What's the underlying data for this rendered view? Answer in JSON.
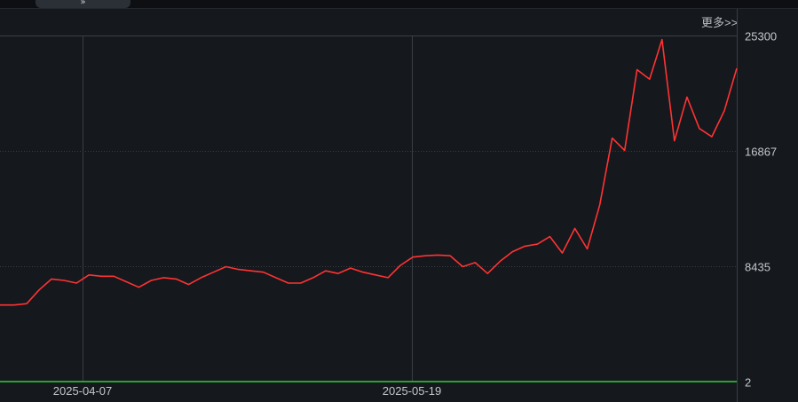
{
  "header": {
    "more_label": "更多>>",
    "collapse_icon": "double-chevron-down-icon"
  },
  "colors": {
    "background": "#15181d",
    "grid": "#3a3e45",
    "axis_text": "#c4c7cc",
    "series_main": "#ff3333",
    "series_baseline": "#2ecc40"
  },
  "chart_data": {
    "type": "line",
    "title": "",
    "xlabel": "",
    "ylabel": "",
    "ylim": [
      2,
      25300
    ],
    "y_ticks": [
      25300,
      16867,
      8435,
      2
    ],
    "x_tick_labels": [
      "2025-04-07",
      "2025-05-19"
    ],
    "y_axis_side": "right",
    "grid": true,
    "series": [
      {
        "values": [
          5600,
          5600,
          5700,
          6700,
          7500,
          7400,
          7200,
          7800,
          7700,
          7700,
          7300,
          6900,
          7400,
          7600,
          7500,
          7100,
          7600,
          8000,
          8400,
          8200,
          8100,
          8000,
          7600,
          7200,
          7200,
          7600,
          8100,
          7900,
          8300,
          8000,
          7800,
          7600,
          8500,
          9100,
          9200,
          9250,
          9200,
          8400,
          8700,
          7900,
          8800,
          9500,
          9900,
          10050,
          10600,
          9400,
          11200,
          9700,
          12900,
          17800,
          16900,
          22800,
          22100,
          25000,
          17600,
          20800,
          18500,
          17900,
          19800,
          22900
        ]
      },
      {
        "values": [
          2,
          2,
          2,
          2,
          2,
          2,
          2,
          2,
          2,
          2,
          2,
          2,
          2,
          2,
          2,
          2,
          2,
          2,
          2,
          2,
          2,
          2,
          2,
          2,
          2,
          2,
          2,
          2,
          2,
          2,
          2,
          2,
          2,
          2,
          2,
          2,
          2,
          2,
          2,
          2,
          2,
          2,
          2,
          2,
          2,
          2,
          2,
          2,
          2,
          2,
          2,
          2,
          2,
          2,
          2,
          2,
          2,
          2,
          2,
          2
        ]
      }
    ]
  }
}
